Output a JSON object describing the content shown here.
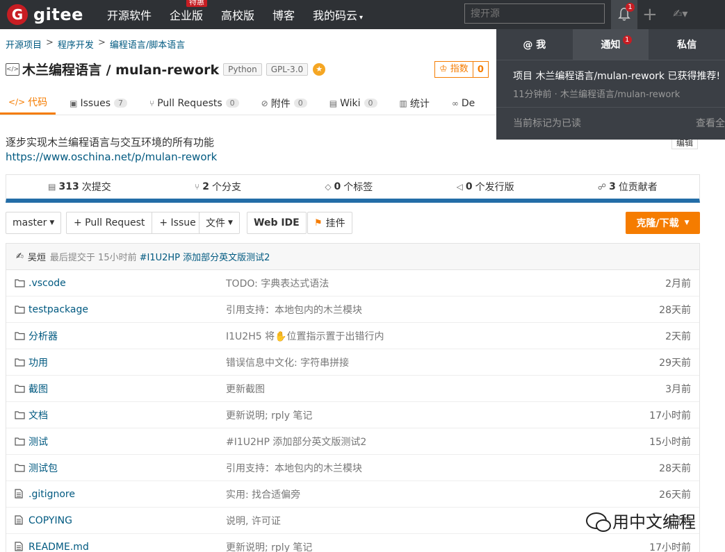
{
  "topnav": {
    "logo_mark": "G",
    "logo_text": "gitee",
    "links": [
      {
        "label": "开源软件"
      },
      {
        "label": "企业版",
        "badge": "特惠"
      },
      {
        "label": "高校版"
      },
      {
        "label": "博客"
      },
      {
        "label": "我的码云",
        "caret": "▾"
      }
    ],
    "search_placeholder": "搜开源",
    "notification_count": "1"
  },
  "breadcrumb": [
    "开源项目",
    "程序开发",
    "编程语言/脚本语言"
  ],
  "breadcrumb_sep": ">",
  "repo": {
    "title": "木兰编程语言 / mulan-rework",
    "language": "Python",
    "license": "GPL-3.0",
    "index_label": "指数",
    "index_value": "0",
    "description": "逐步实现木兰编程语言与交互环境的所有功能",
    "homepage": "https://www.oschina.net/p/mulan-rework",
    "edit_label": "编辑"
  },
  "tabs": [
    {
      "label": "代码",
      "icon": "code-icon",
      "glyph": "</>"
    },
    {
      "label": "Issues",
      "count": "7",
      "glyph": "▣"
    },
    {
      "label": "Pull Requests",
      "count": "0",
      "glyph": "⑂"
    },
    {
      "label": "附件",
      "count": "0",
      "glyph": "⊘"
    },
    {
      "label": "Wiki",
      "count": "0",
      "glyph": "▤"
    },
    {
      "label": "统计",
      "glyph": "▥"
    },
    {
      "label": "De",
      "glyph": "∞"
    }
  ],
  "stats": [
    {
      "num": "313",
      "label": "次提交",
      "glyph": "▤"
    },
    {
      "num": "2",
      "label": "个分支",
      "glyph": "⑂"
    },
    {
      "num": "0",
      "label": "个标签",
      "glyph": "◇"
    },
    {
      "num": "0",
      "label": "个发行版",
      "glyph": "◁"
    },
    {
      "num": "3",
      "label": "位贡献者",
      "glyph": "☍"
    }
  ],
  "toolbar": {
    "branch": "master",
    "pull_request": "+ Pull Request",
    "issue": "+ Issue",
    "file": "文件",
    "web_ide": "Web IDE",
    "pendant": "挂件",
    "clone": "克隆/下载"
  },
  "latest_commit": {
    "author": "吴烜",
    "meta": "最后提交于 15小时前",
    "message": "#I1U2HP 添加部分英文版测试2"
  },
  "files": [
    {
      "type": "folder",
      "name": ".vscode",
      "message": "TODO: 字典表达式语法",
      "time": "2月前"
    },
    {
      "type": "folder",
      "name": "testpackage",
      "message": "引用支持：本地包内的木兰模块",
      "time": "28天前"
    },
    {
      "type": "folder",
      "name": "分析器",
      "message": "I1U2H5 将✋位置指示置于出错行内",
      "time": "2天前"
    },
    {
      "type": "folder",
      "name": "功用",
      "message": "错误信息中文化: 字符串拼接",
      "time": "29天前"
    },
    {
      "type": "folder",
      "name": "截图",
      "message": "更新截图",
      "time": "3月前"
    },
    {
      "type": "folder",
      "name": "文档",
      "message": "更新说明; rply 笔记",
      "time": "17小时前"
    },
    {
      "type": "folder",
      "name": "测试",
      "message": "#I1U2HP 添加部分英文版测试2",
      "time": "15小时前"
    },
    {
      "type": "folder",
      "name": "测试包",
      "message": "引用支持：本地包内的木兰模块",
      "time": "28天前"
    },
    {
      "type": "file",
      "name": ".gitignore",
      "message": "实用: 找合适偏旁",
      "time": "26天前"
    },
    {
      "type": "file",
      "name": "COPYING",
      "message": "说明, 许可证",
      "time": "4月前"
    },
    {
      "type": "file",
      "name": "README.md",
      "message": "更新说明; rply 笔记",
      "time": "17小时前"
    }
  ],
  "notifications": {
    "tabs": [
      {
        "label": "@ 我"
      },
      {
        "label": "通知",
        "count": "1"
      },
      {
        "label": "私信"
      }
    ],
    "item_title": "项目 木兰编程语言/mulan-rework 已获得推荐!",
    "item_sub": "11分钟前 · 木兰编程语言/mulan-rework",
    "mark_read": "当前标记为已读",
    "view_all": "查看全"
  },
  "watermark": "用中文编程"
}
